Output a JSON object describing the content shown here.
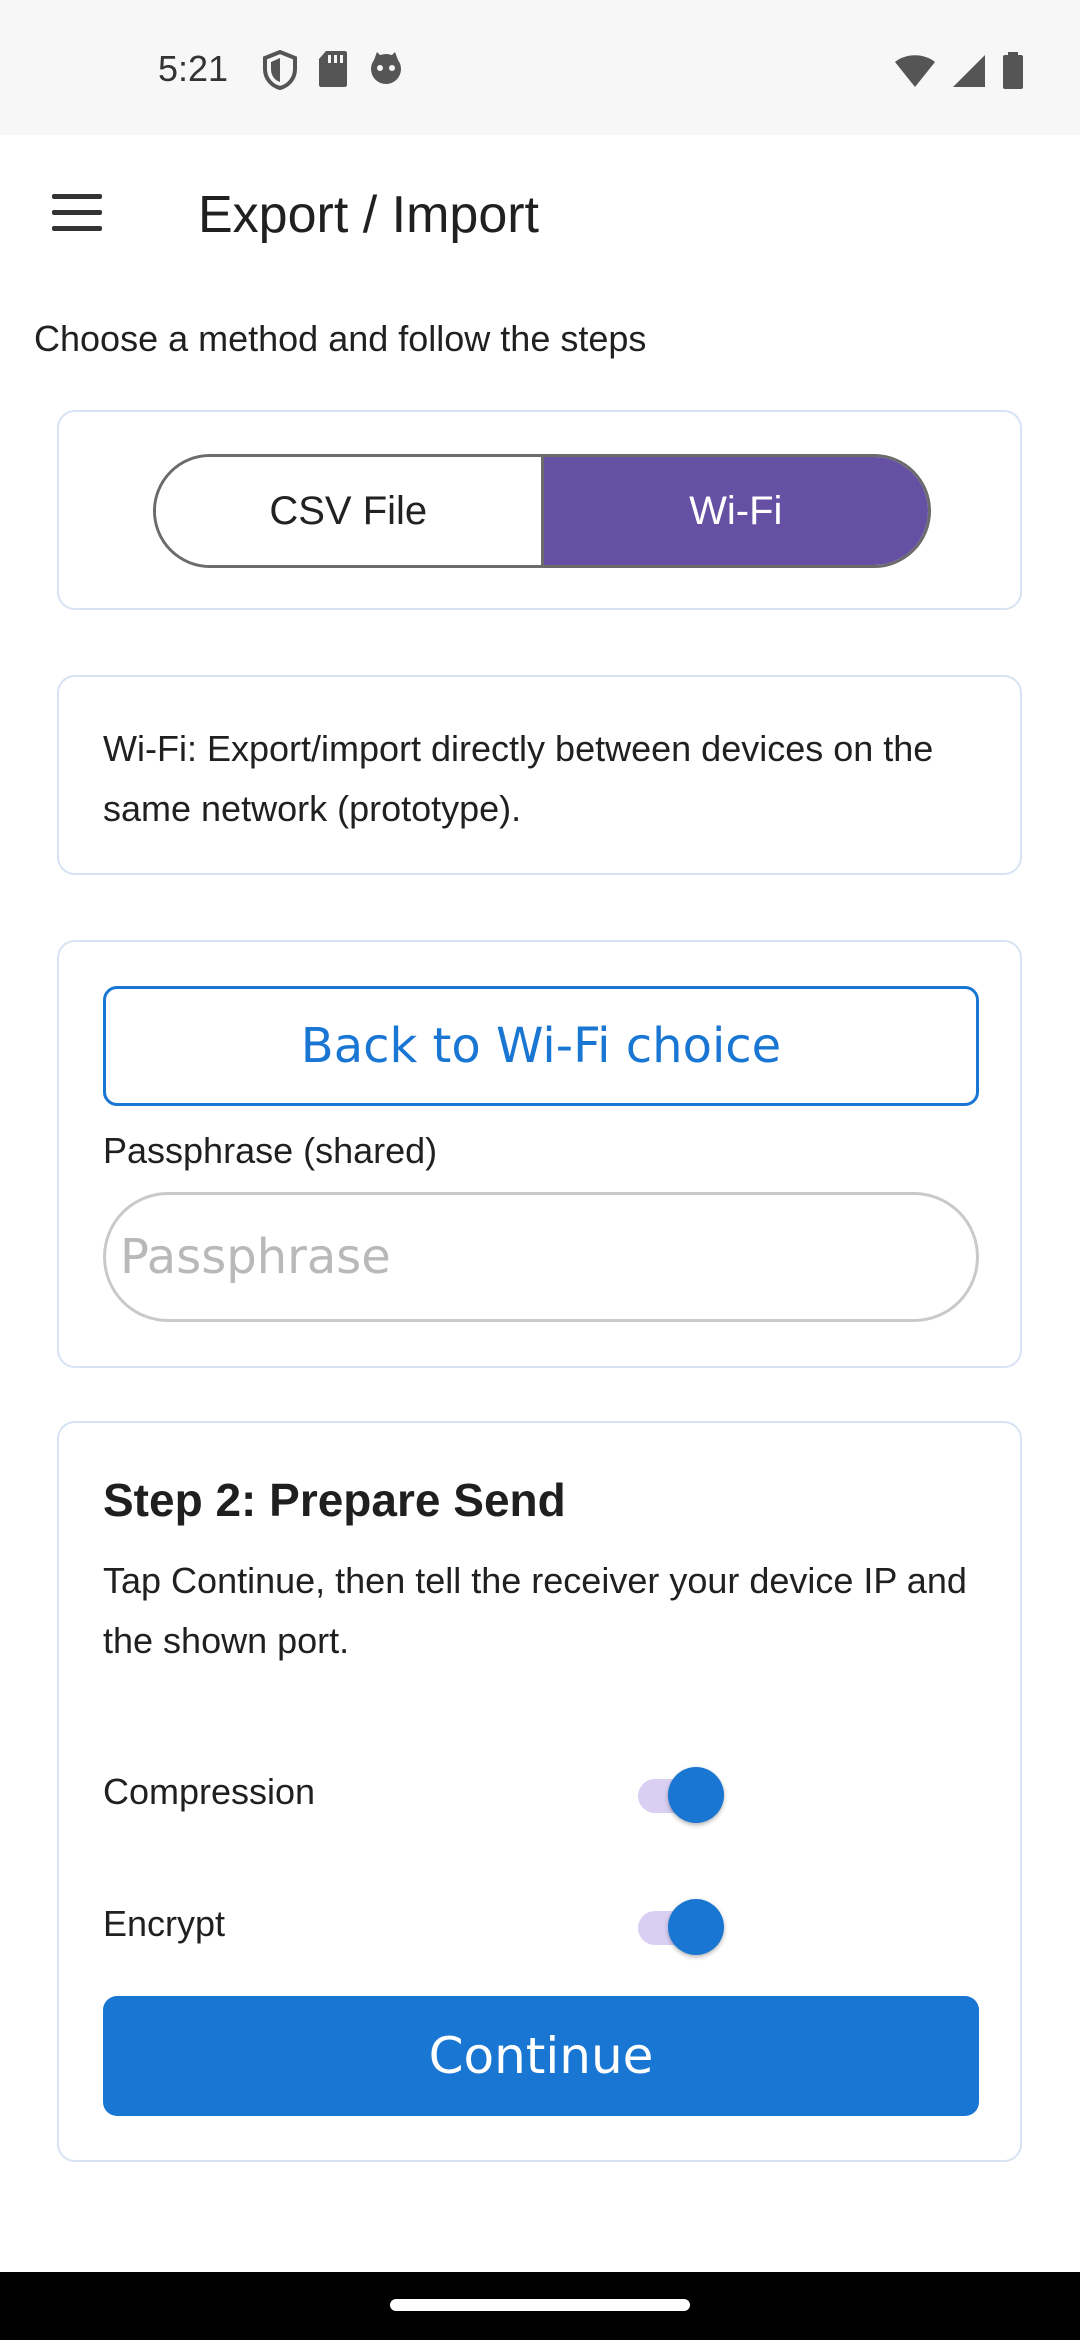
{
  "status_bar": {
    "time": "5:21",
    "left_icons": [
      "shield-icon",
      "sd-card-icon",
      "cat-icon"
    ],
    "right_icons": [
      "wifi-icon",
      "signal-icon",
      "battery-icon"
    ]
  },
  "app_bar": {
    "title": "Export / Import",
    "menu_icon": "hamburger-menu-icon"
  },
  "subtitle": "Choose a method and follow the steps",
  "method_selector": {
    "options": [
      "CSV File",
      "Wi-Fi"
    ],
    "selected": "Wi-Fi"
  },
  "info_card": {
    "text": "Wi-Fi: Export/import directly between devices on the same network (prototype)."
  },
  "wifi_card": {
    "back_button": "Back to Wi-Fi choice",
    "passphrase_label": "Passphrase (shared)",
    "passphrase_placeholder": "Passphrase",
    "passphrase_value": ""
  },
  "step_card": {
    "title": "Step 2: Prepare Send",
    "description": "Tap Continue, then tell the receiver your device IP and the shown port.",
    "toggles": [
      {
        "label": "Compression",
        "on": true
      },
      {
        "label": "Encrypt",
        "on": true
      }
    ],
    "continue_button": "Continue"
  },
  "colors": {
    "accent_blue": "#1976d2",
    "selected_purple": "#6650a4",
    "card_border": "#d7e3f3",
    "switch_track": "#d9cff3"
  }
}
